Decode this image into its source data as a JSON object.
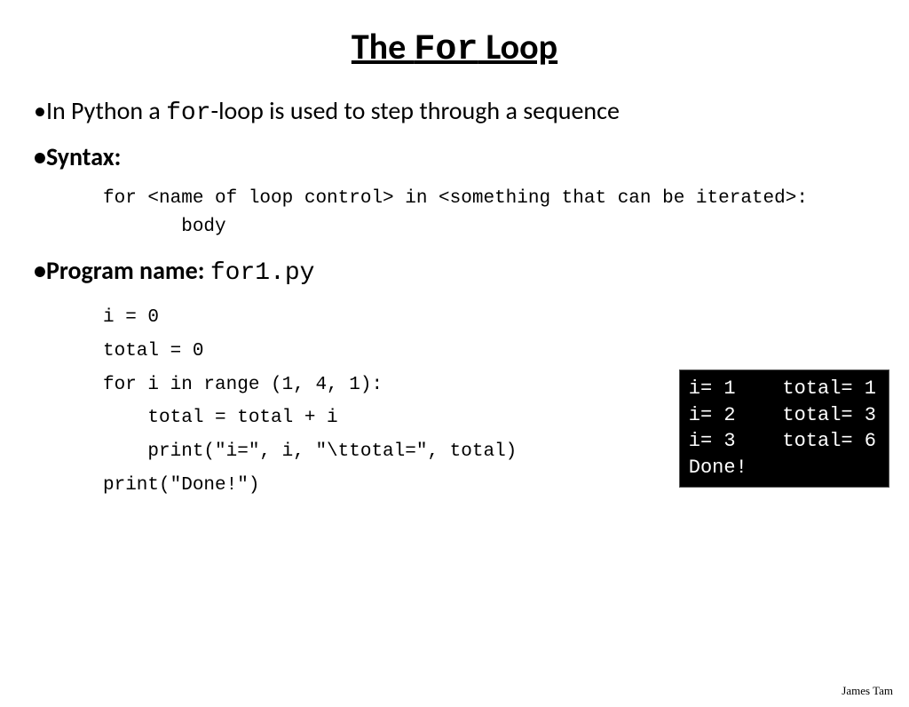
{
  "title": {
    "pre": "The ",
    "kw": "For",
    "post": " Loop"
  },
  "bullets": {
    "intro": {
      "pre": "•In Python a ",
      "kw": "for",
      "post": "-loop is used to step through a sequence"
    },
    "syntax_label": "•Syntax:",
    "program": {
      "pre": "•Program name: ",
      "file": "for1.py"
    }
  },
  "syntax_code": "for <name of loop control> in <something that can be iterated>:\n       body",
  "code": "i = 0\ntotal = 0\nfor i in range (1, 4, 1):\n    total = total + i\n    print(\"i=\", i, \"\\ttotal=\", total)\nprint(\"Done!\")",
  "terminal": "i= 1    total= 1\ni= 2    total= 3\ni= 3    total= 6\nDone!",
  "footer": "James Tam"
}
